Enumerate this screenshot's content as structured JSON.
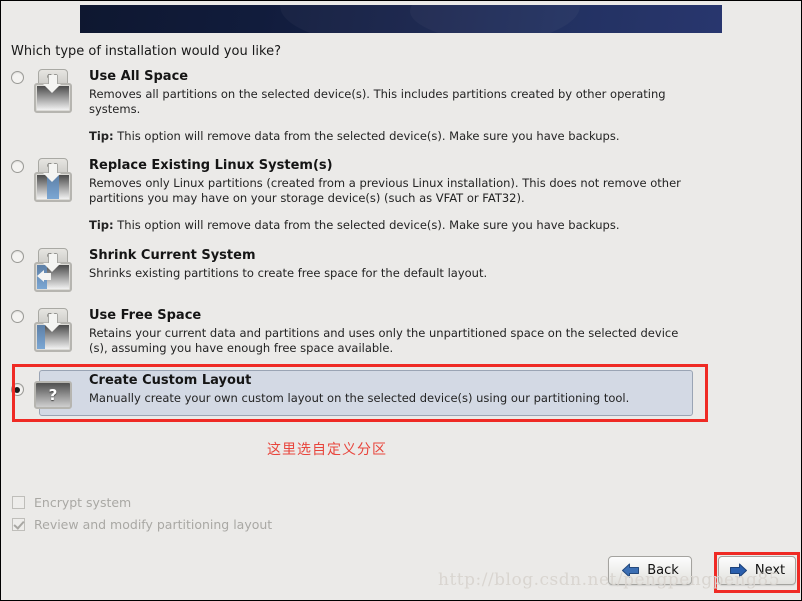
{
  "window": {
    "background_color": "#ebeae8",
    "banner_color_start": "#0e1730",
    "banner_color_end": "#22306a"
  },
  "question": "Which type of installation would you like?",
  "options": [
    {
      "id": "use-all-space",
      "title": "Use All Space",
      "description": "Removes all partitions on the selected device(s).  This includes partitions created by other operating systems.",
      "tip_label": "Tip:",
      "tip_text": "This option will remove data from the selected device(s).  Make sure you have backups.",
      "icon": "disk-all-space-icon",
      "icon_badge": "OS",
      "selected": false
    },
    {
      "id": "replace-existing-linux",
      "title": "Replace Existing Linux System(s)",
      "description": "Removes only Linux partitions (created from a previous Linux installation).  This does not remove other partitions you may have on your storage device(s) (such as VFAT or FAT32).",
      "tip_label": "Tip:",
      "tip_text": "This option will remove data from the selected device(s).  Make sure you have backups.",
      "icon": "disk-replace-linux-icon",
      "icon_badge": "OS",
      "selected": false
    },
    {
      "id": "shrink-current-system",
      "title": "Shrink Current System",
      "description": "Shrinks existing partitions to create free space for the default layout.",
      "tip_label": "",
      "tip_text": "",
      "icon": "disk-shrink-icon",
      "icon_badge": "OS",
      "selected": false
    },
    {
      "id": "use-free-space",
      "title": "Use Free Space",
      "description": "Retains your current data and partitions and uses only the unpartitioned space on the selected device (s), assuming you have enough free space available.",
      "tip_label": "",
      "tip_text": "",
      "icon": "disk-free-space-icon",
      "icon_badge": "OS",
      "selected": false
    },
    {
      "id": "create-custom-layout",
      "title": "Create Custom Layout",
      "description": "Manually create your own custom layout on the selected device(s) using our partitioning tool.",
      "tip_label": "",
      "tip_text": "",
      "icon": "disk-question-mark-icon",
      "icon_badge": "?",
      "selected": true
    }
  ],
  "annotation": {
    "text": "这里选自定义分区",
    "color": "#e8453c"
  },
  "checkboxes": [
    {
      "id": "encrypt-system",
      "label": "Encrypt system",
      "checked": false,
      "disabled": true
    },
    {
      "id": "review-modify-partitioning",
      "label": "Review and modify partitioning layout",
      "checked": true,
      "disabled": true
    }
  ],
  "buttons": {
    "back": {
      "label": "Back",
      "icon": "arrow-left-icon"
    },
    "next": {
      "label": "Next",
      "icon": "arrow-right-icon",
      "highlight_color": "#ef2a24"
    }
  },
  "watermark": "http://blog.csdn.net/pengpengpeng85"
}
